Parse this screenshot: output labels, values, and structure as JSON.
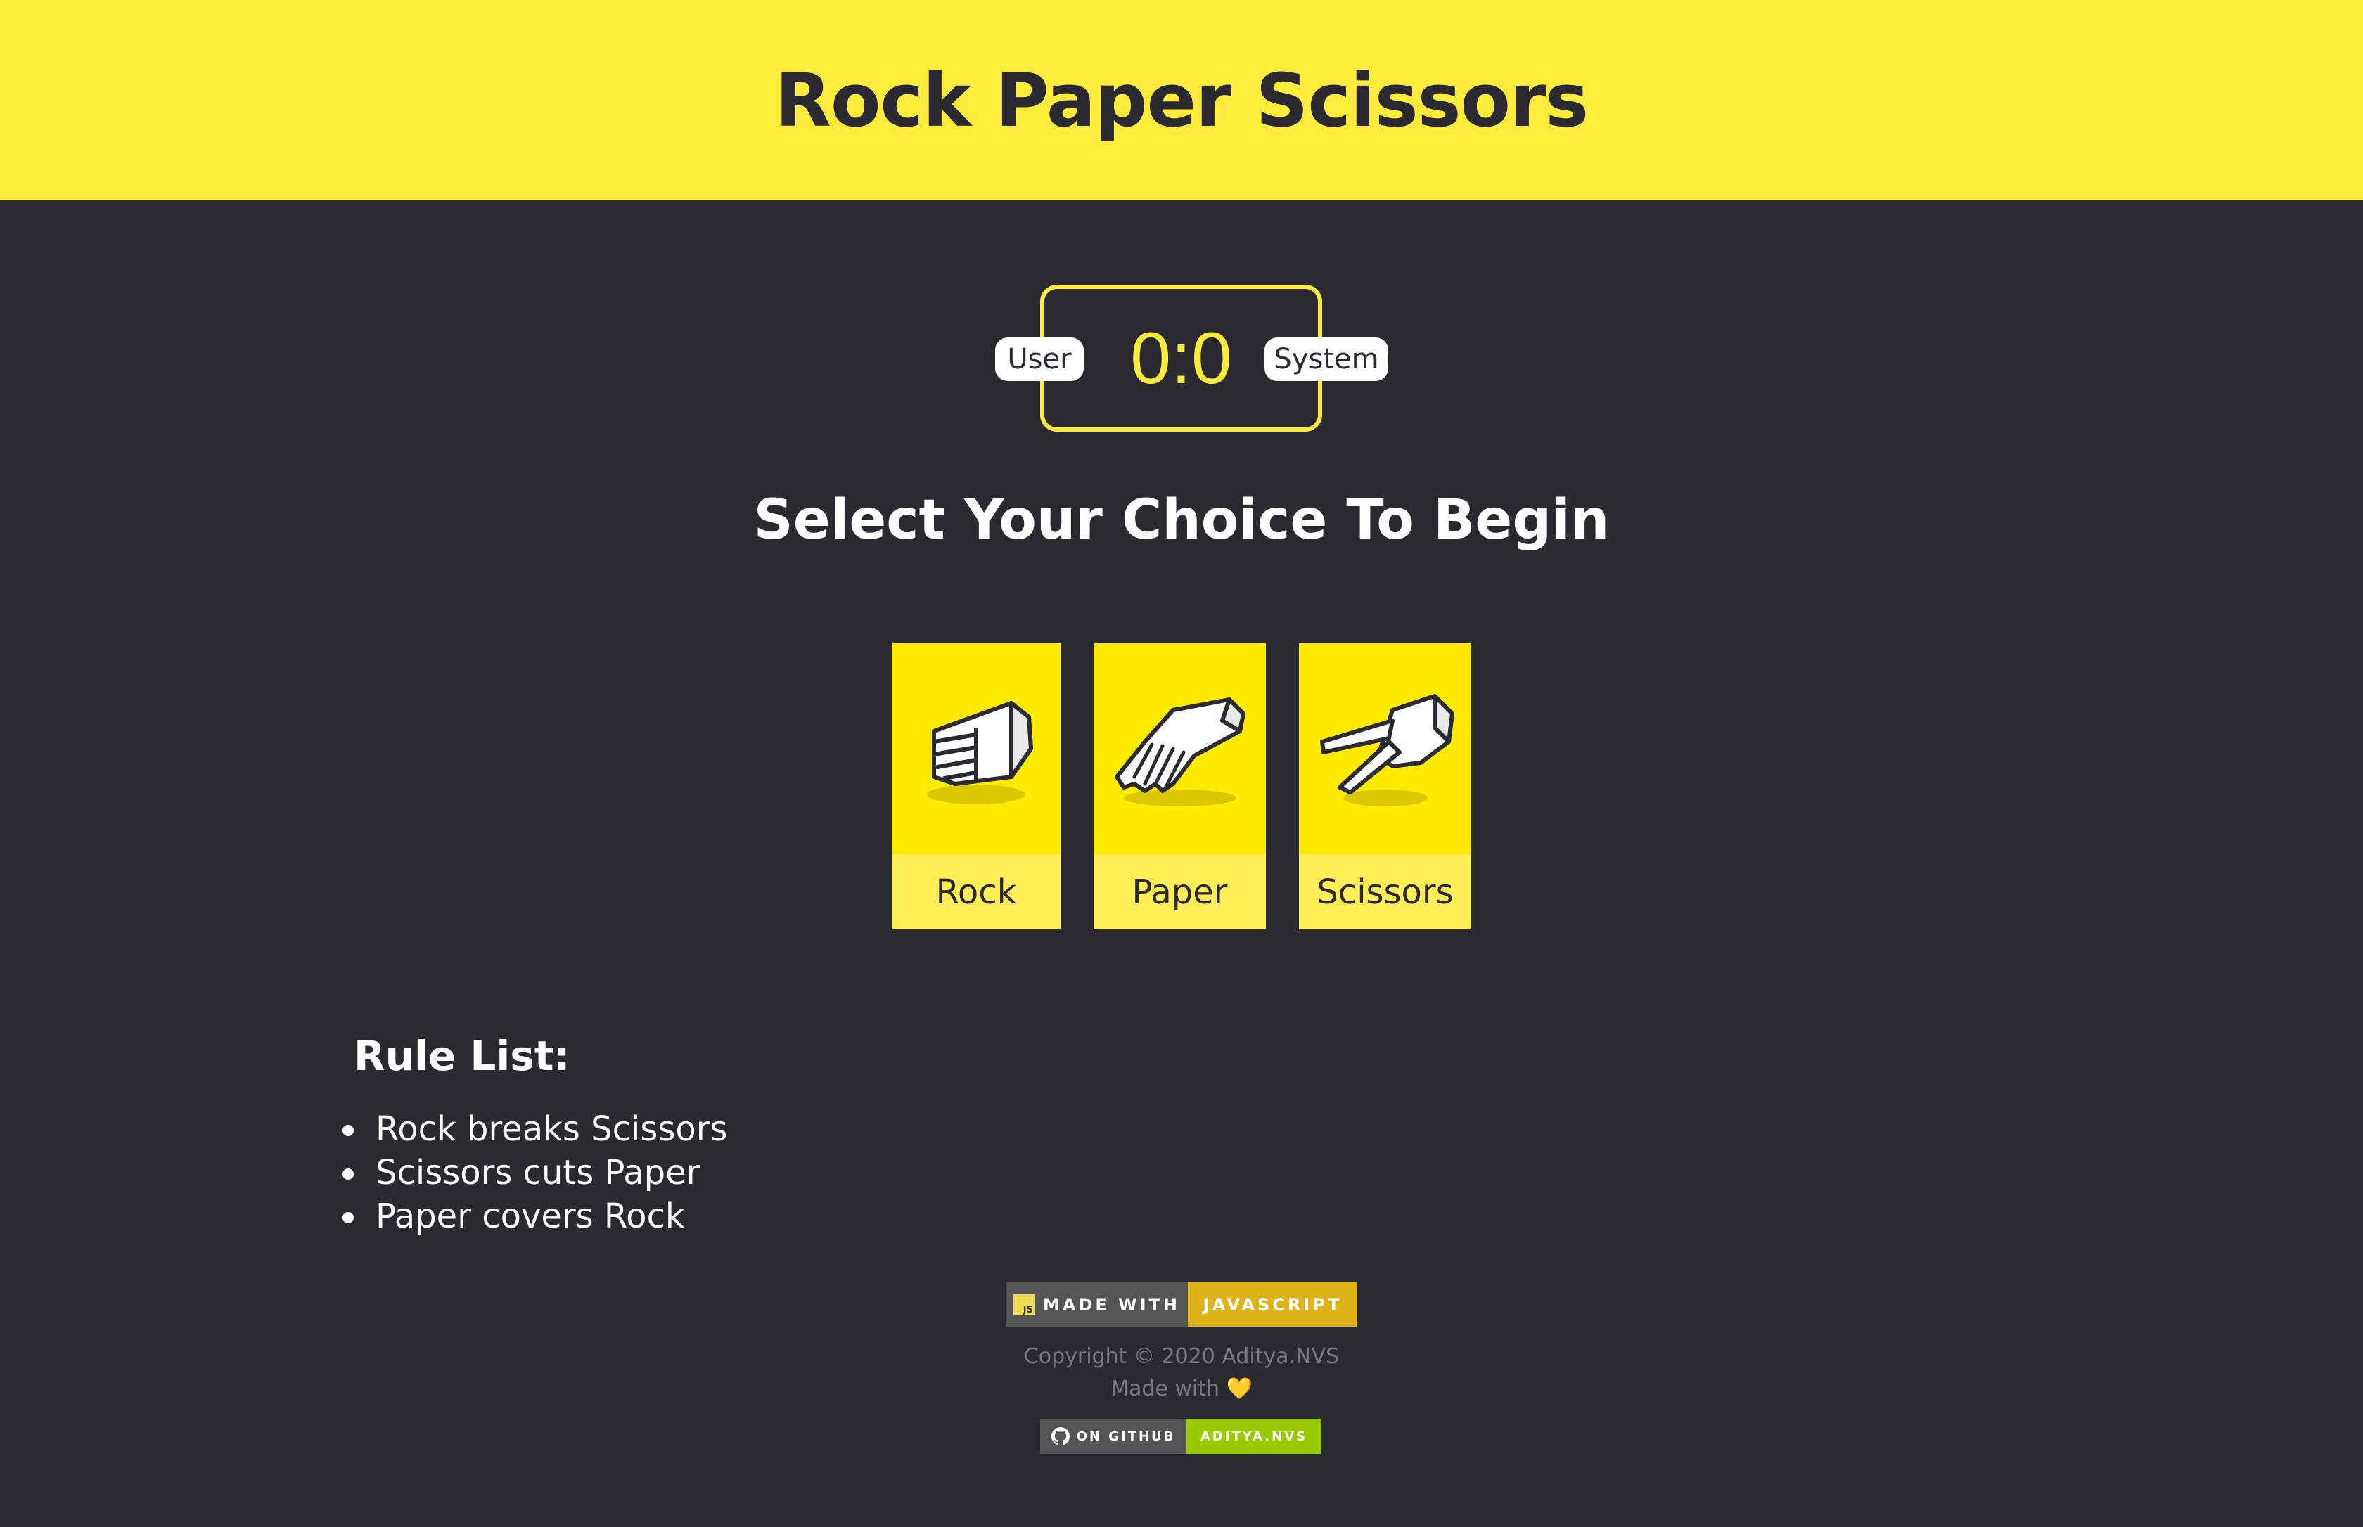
{
  "header": {
    "title": "Rock Paper Scissors"
  },
  "scoreboard": {
    "user_label": "User",
    "system_label": "System",
    "score": "0:0"
  },
  "instruction": "Select Your Choice To Begin",
  "choices": [
    {
      "label": "Rock",
      "icon": "rock-hand-icon"
    },
    {
      "label": "Paper",
      "icon": "paper-hand-icon"
    },
    {
      "label": "Scissors",
      "icon": "scissors-hand-icon"
    }
  ],
  "rules": {
    "title": "Rule List:",
    "items": [
      "Rock breaks Scissors",
      "Scissors cuts Paper",
      "Paper covers Rock"
    ]
  },
  "footer": {
    "js_badge": {
      "left": "Made with",
      "right": "JavaScript",
      "icon": "js-icon",
      "badge_letters": "JS"
    },
    "copyright": "Copyright © 2020 Aditya.NVS",
    "made_with": "Made with",
    "heart": "💛",
    "github_badge": {
      "left": "On GitHub",
      "right": "Aditya.NVS",
      "icon": "github-icon"
    }
  },
  "colors": {
    "accent": "#ffeb3b",
    "background": "#2b2a31",
    "js_badge_right": "#dfb317",
    "github_badge_right": "#97ca00"
  }
}
